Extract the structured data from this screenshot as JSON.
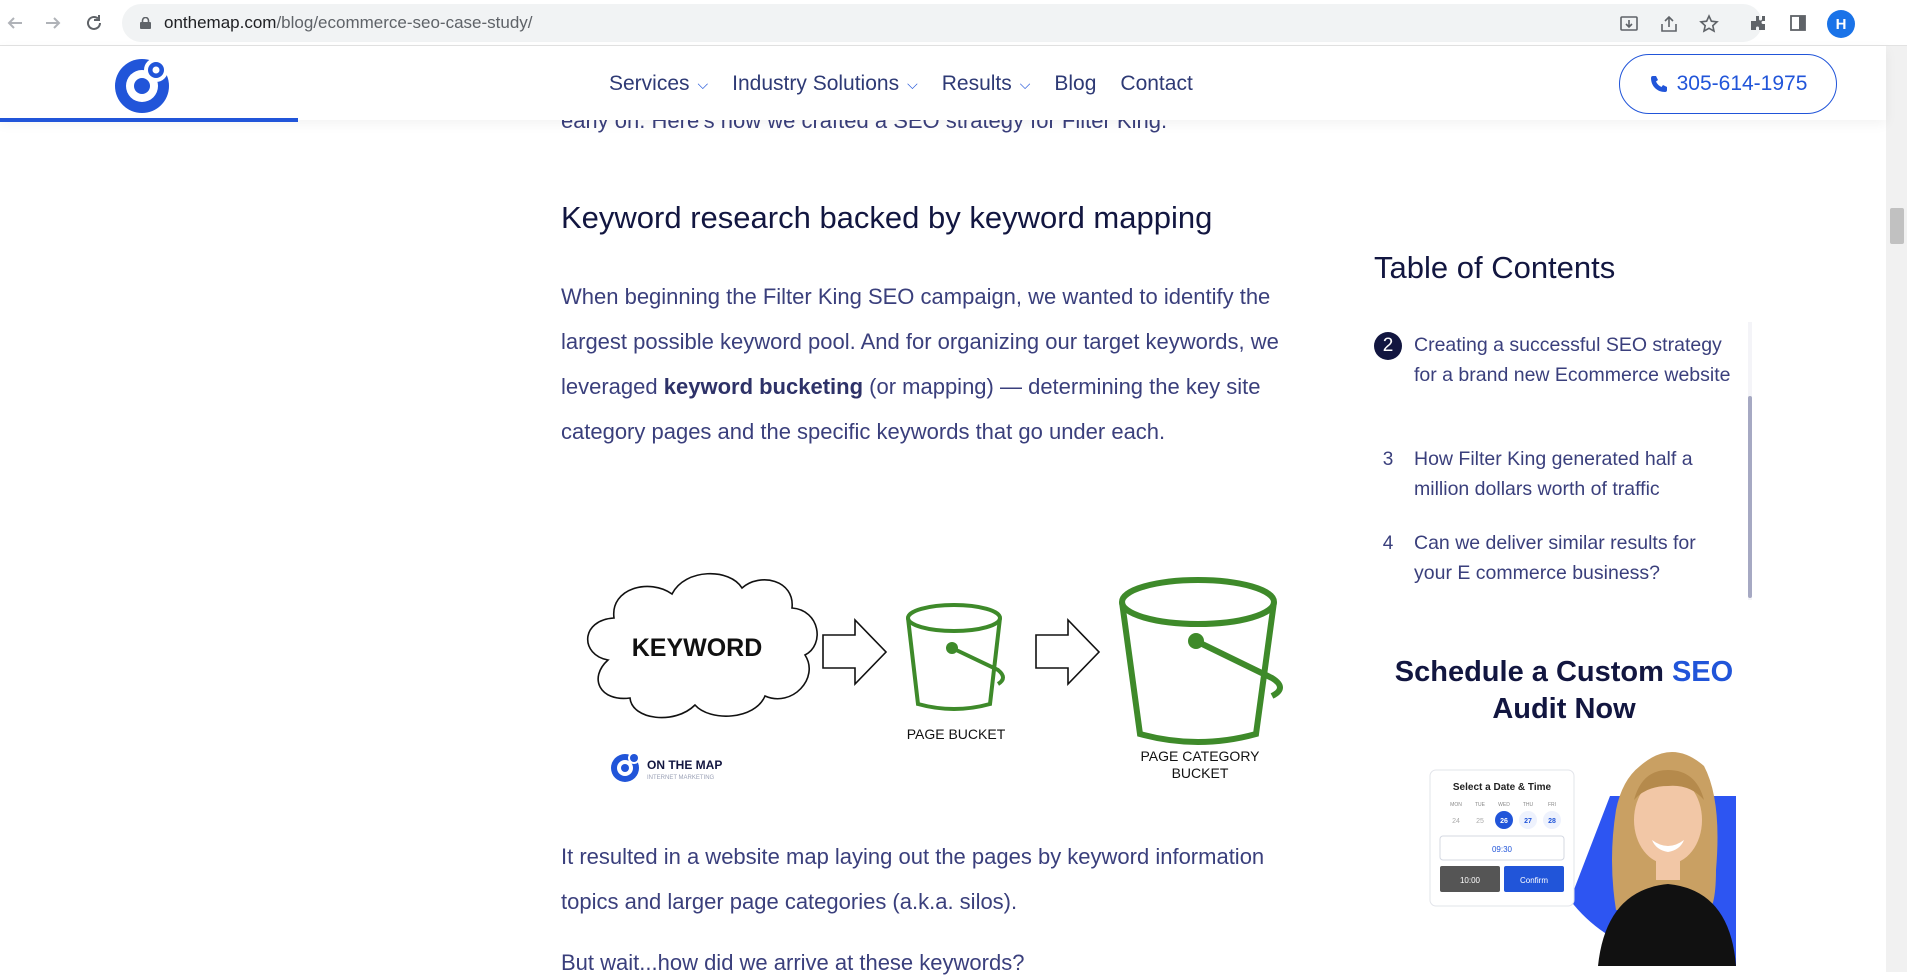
{
  "browser": {
    "url_host": "onthemap.com",
    "url_path": "/blog/ecommerce-seo-case-study/",
    "avatar_letter": "H"
  },
  "header": {
    "nav": [
      {
        "label": "Services",
        "dropdown": true
      },
      {
        "label": "Industry Solutions",
        "dropdown": true
      },
      {
        "label": "Results",
        "dropdown": true
      },
      {
        "label": "Blog",
        "dropdown": false
      },
      {
        "label": "Contact",
        "dropdown": false
      }
    ],
    "phone": "305-614-1975",
    "accent_color": "#2155d9"
  },
  "article": {
    "top_fragment": "early on. Here’s how we crafted a SEO strategy for Filter King.",
    "heading": "Keyword research backed by keyword mapping",
    "para1_a": "When beginning the Filter King SEO campaign, we wanted to identify the largest possible keyword pool. And for organizing our target keywords, we leveraged ",
    "para1_bold": "keyword bucketing",
    "para1_b": " (or mapping) — determining the key site category pages and the specific keywords that go under each.",
    "diagram": {
      "cloud_label": "KEYWORD",
      "bucket_small_label": "PAGE BUCKET",
      "bucket_large_label_1": "PAGE CATEGORY",
      "bucket_large_label_2": "BUCKET",
      "logo_text": "ON THE MAP",
      "logo_sub": "INTERNET MARKETING"
    },
    "para2": "It resulted in a website map laying out the pages by keyword information topics and larger page categories (a.k.a. silos).",
    "para3": "But wait...how did we arrive at these keywords?"
  },
  "toc": {
    "title": "Table of Contents",
    "items": [
      {
        "num": "2",
        "text": "Creating a successful SEO strategy for a brand new Ecommerce website",
        "active": true
      },
      {
        "num": "3",
        "text": "How Filter King generated half a million dollars worth of traffic",
        "active": false
      },
      {
        "num": "4",
        "text": "Can we deliver similar results for your E commerce business?",
        "active": false
      }
    ]
  },
  "cta": {
    "line1": "Schedule a Custom ",
    "accent": "SEO",
    "line2": "Audit Now",
    "widget": {
      "title": "Select a Date & Time",
      "days": [
        "MON",
        "TUE",
        "WED",
        "THU",
        "FRI"
      ],
      "dates": [
        "24",
        "25",
        "26",
        "27",
        "28"
      ],
      "selected_time": "09:30",
      "alt_time": "10:00",
      "confirm": "Confirm"
    }
  }
}
